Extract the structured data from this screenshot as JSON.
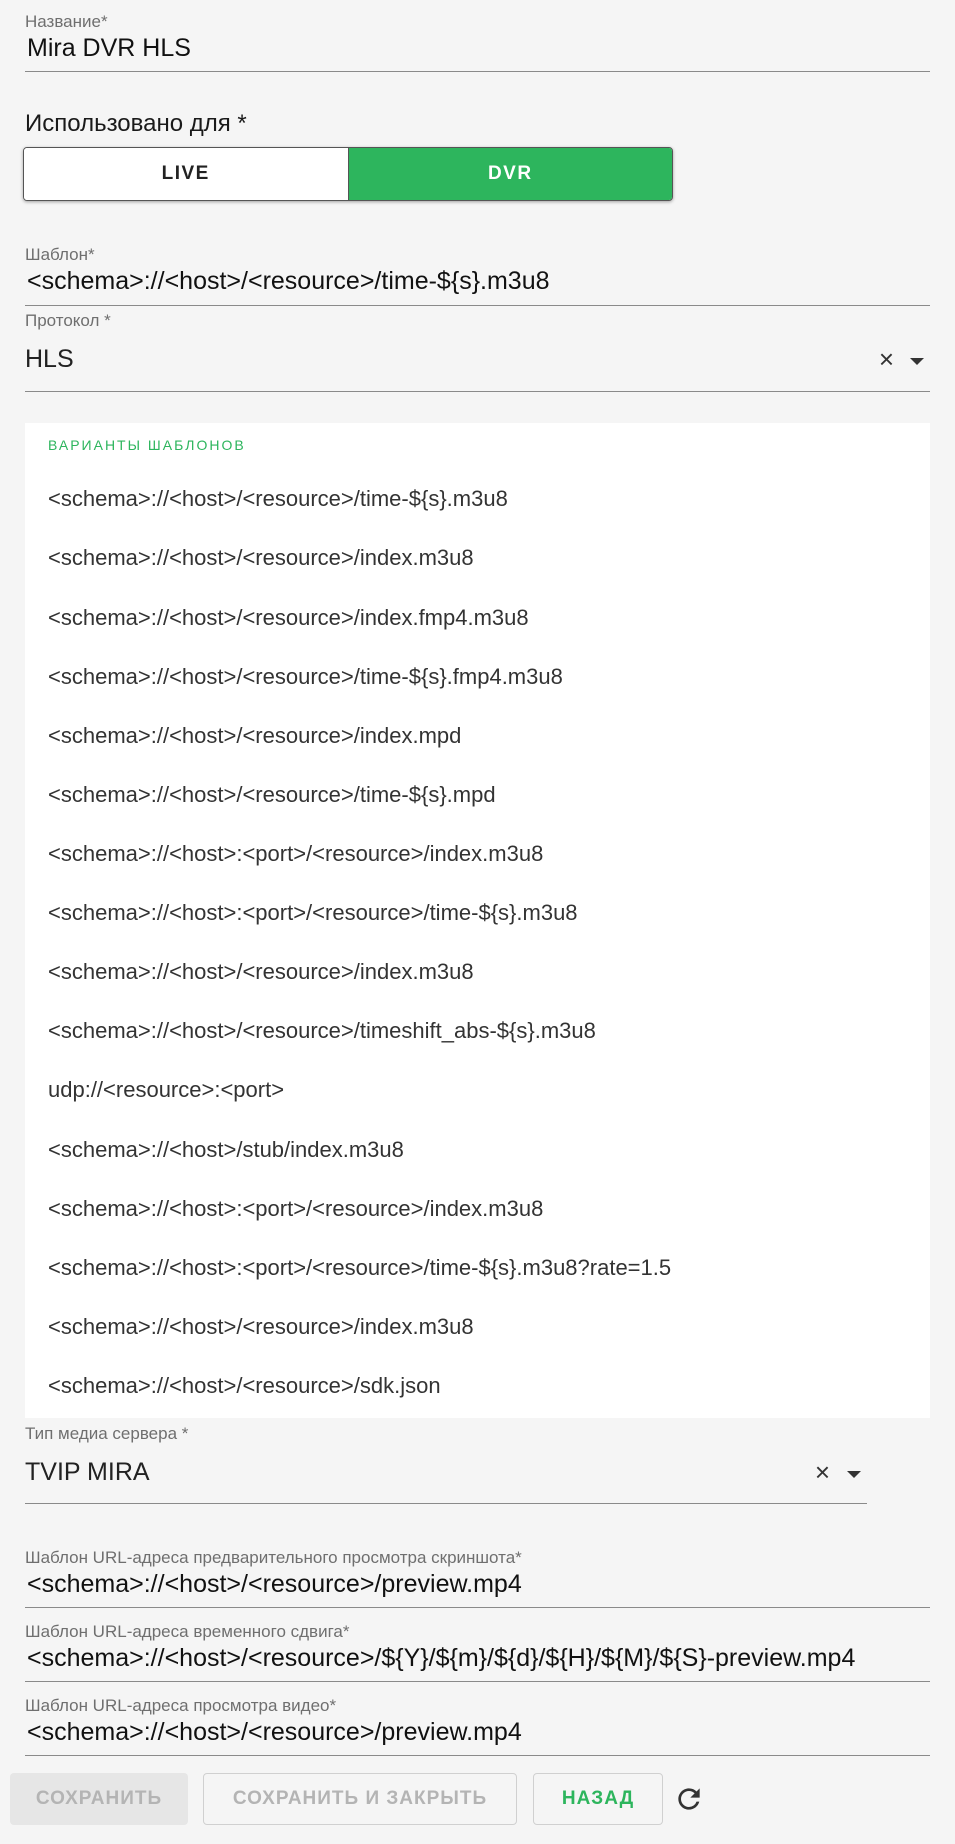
{
  "name_field": {
    "label": "Название*",
    "value": "Mira DVR HLS"
  },
  "used_for": {
    "label": "Использовано для *",
    "options": [
      "LIVE",
      "DVR"
    ],
    "selected": "DVR"
  },
  "template_field": {
    "label": "Шаблон*",
    "value": "<schema>://<host>/<resource>/time-${s}.m3u8"
  },
  "protocol_field": {
    "label": "Протокол *",
    "value": "HLS"
  },
  "template_variants": {
    "header": "ВАРИАНТЫ ШАБЛОНОВ",
    "items": [
      "<schema>://<host>/<resource>/time-${s}.m3u8",
      "<schema>://<host>/<resource>/index.m3u8",
      "<schema>://<host>/<resource>/index.fmp4.m3u8",
      "<schema>://<host>/<resource>/time-${s}.fmp4.m3u8",
      "<schema>://<host>/<resource>/index.mpd",
      "<schema>://<host>/<resource>/time-${s}.mpd",
      "<schema>://<host>:<port>/<resource>/index.m3u8",
      "<schema>://<host>:<port>/<resource>/time-${s}.m3u8",
      "<schema>://<host>/<resource>/index.m3u8",
      "<schema>://<host>/<resource>/timeshift_abs-${s}.m3u8",
      "udp://<resource>:<port>",
      "<schema>://<host>/stub/index.m3u8",
      "<schema>://<host>:<port>/<resource>/index.m3u8",
      "<schema>://<host>:<port>/<resource>/time-${s}.m3u8?rate=1.5",
      "<schema>://<host>/<resource>/index.m3u8",
      "<schema>://<host>/<resource>/sdk.json"
    ]
  },
  "media_server_type": {
    "label": "Тип медиа сервера *",
    "value": "TVIP MIRA"
  },
  "screenshot_preview_template": {
    "label": "Шаблон URL-адреса предварительного просмотра скриншота*",
    "value": "<schema>://<host>/<resource>/preview.mp4"
  },
  "timeshift_template": {
    "label": "Шаблон URL-адреса временного сдвига*",
    "value": "<schema>://<host>/<resource>/${Y}/${m}/${d}/${H}/${M}/${S}-preview.mp4"
  },
  "video_preview_template": {
    "label": "Шаблон URL-адреса просмотра видео*",
    "value": "<schema>://<host>/<resource>/preview.mp4"
  },
  "buttons": {
    "save": "СОХРАНИТЬ",
    "save_and_close": "СОХРАНИТЬ И ЗАКРЫТЬ",
    "back": "НАЗАД"
  },
  "icons": {
    "clear": "close-icon",
    "dropdown": "chevron-down-icon",
    "refresh": "refresh-icon"
  },
  "colors": {
    "accent_green": "#2db55d",
    "disabled_text": "#b4b4b4",
    "background": "#f5f5f5"
  }
}
